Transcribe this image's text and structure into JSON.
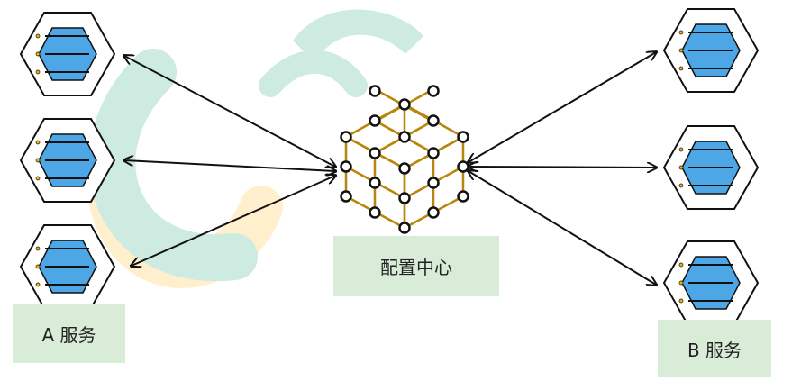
{
  "service_a": {
    "label": "A 服务"
  },
  "service_b": {
    "label": "B 服务"
  },
  "config_center": {
    "label": "配置中心"
  },
  "colors": {
    "hexagon_stroke": "#111111",
    "hexagon_fill": "#ffffff",
    "inner_hexagon_fill": "#4da6e6",
    "lines": "#111111",
    "dots": "#f2b400",
    "arrows": "#111111",
    "cube_edges": "#b8860b",
    "cube_nodes_stroke": "#111111",
    "label_background": "#d9ecd8",
    "watermark_green": "#a7dcc9",
    "watermark_yellow": "#ffe3a3"
  },
  "icons": {
    "service_node": "server-list-hexagon-icon",
    "config_center": "network-cube-icon"
  }
}
